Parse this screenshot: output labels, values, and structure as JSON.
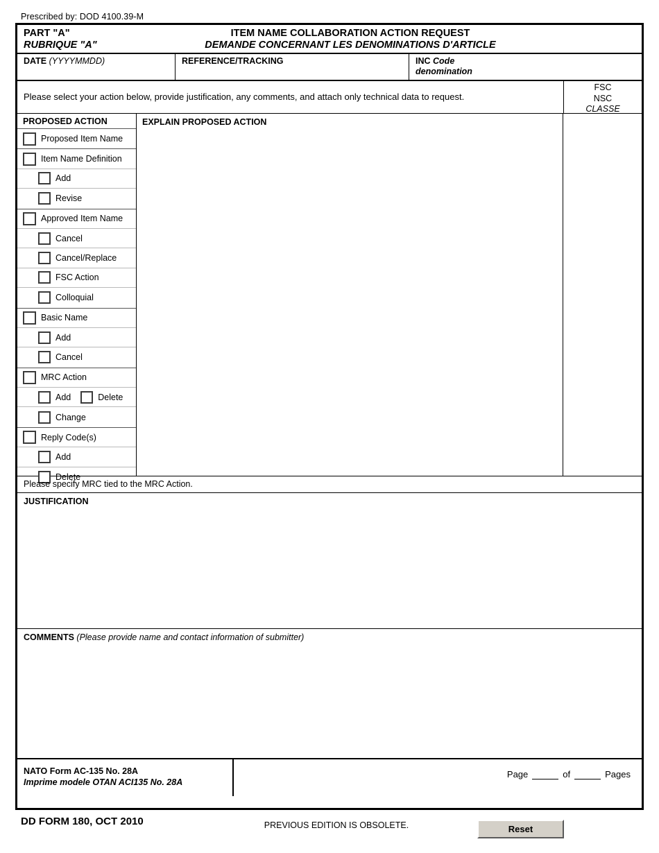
{
  "prescribed_by": "Prescribed by: DOD 4100.39-M",
  "header": {
    "part_en": "PART \"A\"",
    "part_fr": "RUBRIQUE \"A\"",
    "title_en": "ITEM NAME COLLABORATION ACTION REQUEST",
    "title_fr": "DEMANDE CONCERNANT LES DENOMINATIONS D'ARTICLE"
  },
  "ident_row": {
    "date_label": "DATE",
    "date_format": "(YYYYMMDD)",
    "date_value": "",
    "reference_label": "REFERENCE/TRACKING",
    "reference_value": "",
    "inc_label": "INC",
    "inc_label_it": "Code",
    "inc_label_fr": "denomination",
    "inc_value": ""
  },
  "instruction": {
    "text": "Please select your action below, provide justification, any comments, and attach only technical data to request.",
    "fsc_line1": "FSC",
    "fsc_line2": "NSC",
    "fsc_line3": "CLASSE",
    "fsc_value": ""
  },
  "proposed_action": {
    "header": "PROPOSED ACTION",
    "groups": [
      {
        "rows": [
          {
            "level": 1,
            "items": [
              {
                "label": "Proposed Item Name",
                "checked": false
              }
            ]
          }
        ]
      },
      {
        "rows": [
          {
            "level": 1,
            "items": [
              {
                "label": "Item Name Definition",
                "checked": false
              }
            ]
          },
          {
            "level": 2,
            "items": [
              {
                "label": "Add",
                "checked": false
              }
            ]
          },
          {
            "level": 2,
            "items": [
              {
                "label": "Revise",
                "checked": false
              }
            ]
          }
        ]
      },
      {
        "rows": [
          {
            "level": 1,
            "items": [
              {
                "label": "Approved Item Name",
                "checked": false
              }
            ]
          },
          {
            "level": 2,
            "items": [
              {
                "label": "Cancel",
                "checked": false
              }
            ]
          },
          {
            "level": 2,
            "items": [
              {
                "label": "Cancel/Replace",
                "checked": false
              }
            ]
          },
          {
            "level": 2,
            "items": [
              {
                "label": "FSC Action",
                "checked": false
              }
            ]
          },
          {
            "level": 2,
            "items": [
              {
                "label": "Colloquial",
                "checked": false
              }
            ]
          }
        ]
      },
      {
        "rows": [
          {
            "level": 1,
            "items": [
              {
                "label": "Basic Name",
                "checked": false
              }
            ]
          },
          {
            "level": 2,
            "items": [
              {
                "label": "Add",
                "checked": false
              }
            ]
          },
          {
            "level": 2,
            "items": [
              {
                "label": "Cancel",
                "checked": false
              }
            ]
          }
        ]
      },
      {
        "rows": [
          {
            "level": 1,
            "items": [
              {
                "label": "MRC Action",
                "checked": false
              }
            ]
          },
          {
            "level": 2,
            "items": [
              {
                "label": "Add",
                "checked": false
              },
              {
                "label": "Delete",
                "checked": false
              }
            ]
          },
          {
            "level": 2,
            "items": [
              {
                "label": "Change",
                "checked": false
              }
            ]
          }
        ]
      },
      {
        "rows": [
          {
            "level": 1,
            "items": [
              {
                "label": "Reply Code(s)",
                "checked": false
              }
            ]
          },
          {
            "level": 2,
            "items": [
              {
                "label": "Add",
                "checked": false
              }
            ]
          },
          {
            "level": 2,
            "items": [
              {
                "label": "Delete",
                "checked": false
              }
            ]
          }
        ]
      }
    ]
  },
  "explain": {
    "header": "EXPLAIN PROPOSED ACTION",
    "value": ""
  },
  "mrc_note": "Please specify MRC tied to the MRC Action.",
  "justification": {
    "header": "JUSTIFICATION",
    "value": ""
  },
  "comments": {
    "header": "COMMENTS",
    "hint": "(Please provide name and contact information of submitter)",
    "value": ""
  },
  "footer": {
    "nato_form_en": "NATO Form AC-135 No. 28A",
    "nato_form_fr": "Imprime modele OTAN ACI135 No. 28A",
    "page_label": "Page",
    "of_label": "of",
    "pages_label": "Pages",
    "page_value": "",
    "pages_value": "",
    "dd_form": "DD FORM 180, OCT 2010",
    "previous_edition": "PREVIOUS EDITION IS OBSOLETE.",
    "reset_label": "Reset"
  }
}
